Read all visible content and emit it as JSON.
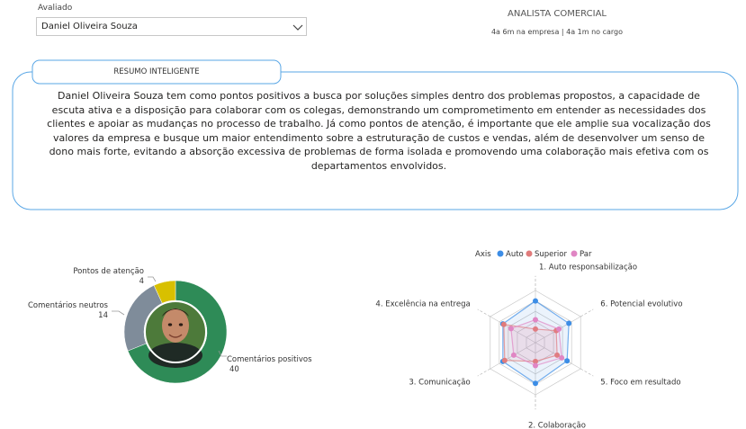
{
  "filter": {
    "label": "Avaliado",
    "selected": "Daniel Oliveira Souza",
    "chevron_icon": "chevron-down-icon"
  },
  "header": {
    "role": "ANALISTA COMERCIAL",
    "tenure": "4a 6m na empresa  | 4a 1m no cargo"
  },
  "resumo": {
    "title": "RESUMO INTELIGENTE",
    "text": "Daniel Oliveira Souza tem como pontos positivos a busca por soluções simples dentro dos problemas propostos, a capacidade de escuta ativa e a disposição para colaborar com os colegas, demonstrando um comprometimento em entender as necessidades dos clientes e apoiar as mudanças no processo de trabalho. Já como pontos de atenção, é importante que ele amplie sua vocalização dos valores da empresa e busque um maior entendimento sobre a estruturação de custos e vendas, além de desenvolver um senso de dono mais forte, evitando a absorção excessiva de problemas de forma isolada e promovendo uma colaboração mais efetiva com os departamentos envolvidos.",
    "frame_color": "#5aa7e6"
  },
  "chart_data": [
    {
      "type": "pie",
      "variant": "donut",
      "center_image": "avatar",
      "categories": [
        "Comentários positivos",
        "Comentários neutros",
        "Pontos de atenção"
      ],
      "values": [
        40,
        14,
        4
      ],
      "colors": [
        "#2e8b57",
        "#7f8c9a",
        "#d8c000"
      ]
    },
    {
      "type": "radar",
      "legend": {
        "title": "Axis",
        "position": "top",
        "items": [
          {
            "name": "Auto",
            "color": "#3c8de6"
          },
          {
            "name": "Superior",
            "color": "#e07b7b"
          },
          {
            "name": "Par",
            "color": "#e086c4"
          }
        ]
      },
      "axes": [
        "1. Auto responsabilização",
        "6. Potencial evolutivo",
        "5. Foco em resultado",
        "2. Colaboração",
        "3. Comunicação",
        "4. Excelência na entrega"
      ],
      "range": [
        0,
        5
      ],
      "series": [
        {
          "name": "Auto",
          "values": [
            4.0,
            3.7,
            3.5,
            3.9,
            3.6,
            3.6
          ]
        },
        {
          "name": "Superior",
          "values": [
            1.3,
            2.3,
            2.4,
            1.8,
            3.4,
            3.5
          ]
        },
        {
          "name": "Par",
          "values": [
            2.2,
            2.6,
            2.9,
            2.2,
            2.4,
            2.7
          ]
        }
      ]
    }
  ]
}
